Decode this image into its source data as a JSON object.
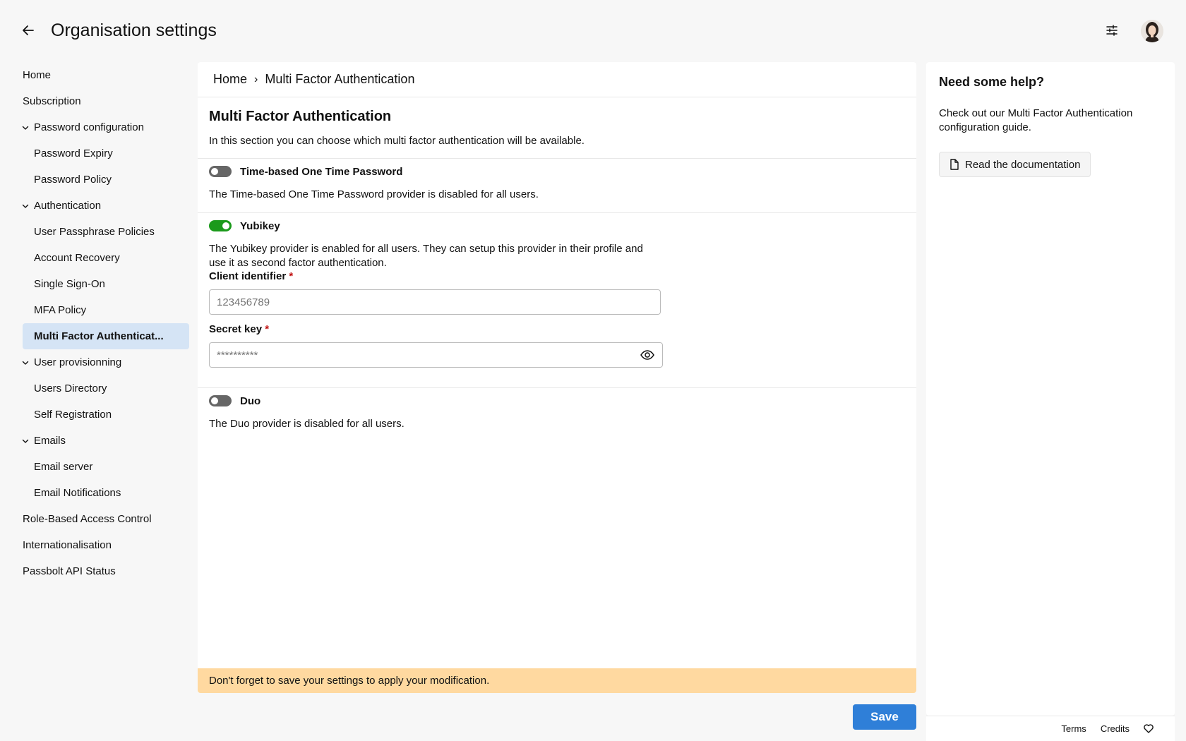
{
  "header": {
    "title": "Organisation settings",
    "back_icon": "arrow-left-icon",
    "filter_icon": "sliders-icon"
  },
  "sidebar": {
    "items": [
      {
        "label": "Home",
        "level": 0
      },
      {
        "label": "Subscription",
        "level": 0
      },
      {
        "label": "Password configuration",
        "level": 0,
        "expanded": true
      },
      {
        "label": "Password Expiry",
        "level": 1
      },
      {
        "label": "Password Policy",
        "level": 1
      },
      {
        "label": "Authentication",
        "level": 0,
        "expanded": true
      },
      {
        "label": "User Passphrase Policies",
        "level": 1
      },
      {
        "label": "Account Recovery",
        "level": 1
      },
      {
        "label": "Single Sign-On",
        "level": 1
      },
      {
        "label": "MFA Policy",
        "level": 1
      },
      {
        "label": "Multi Factor Authenticat...",
        "level": 1,
        "active": true
      },
      {
        "label": "User provisionning",
        "level": 0,
        "expanded": true
      },
      {
        "label": "Users Directory",
        "level": 1
      },
      {
        "label": "Self Registration",
        "level": 1
      },
      {
        "label": "Emails",
        "level": 0,
        "expanded": true
      },
      {
        "label": "Email server",
        "level": 1
      },
      {
        "label": "Email Notifications",
        "level": 1
      },
      {
        "label": "Role-Based Access Control",
        "level": 0
      },
      {
        "label": "Internationalisation",
        "level": 0
      },
      {
        "label": "Passbolt API Status",
        "level": 0
      }
    ]
  },
  "breadcrumb": {
    "home": "Home",
    "separator": "›",
    "current": "Multi Factor Authentication"
  },
  "main": {
    "title": "Multi Factor Authentication",
    "description": "In this section you can choose which multi factor authentication will be available.",
    "totp": {
      "name": "Time-based One Time Password",
      "enabled": false,
      "description": "The Time-based One Time Password provider is disabled for all users."
    },
    "yubikey": {
      "name": "Yubikey",
      "enabled": true,
      "description": "The Yubikey provider is enabled for all users. They can setup this provider in their profile and use it as second factor authentication.",
      "client_label": "Client identifier",
      "client_value": "123456789",
      "secret_label": "Secret key",
      "secret_value": "**********",
      "required_mark": "*"
    },
    "duo": {
      "name": "Duo",
      "enabled": false,
      "description": "The Duo provider is disabled for all users."
    },
    "warning": "Don't forget to save your settings to apply your modification.",
    "save_label": "Save"
  },
  "help": {
    "title": "Need some help?",
    "text": "Check out our Multi Factor Authentication configuration guide.",
    "doc_button": "Read the documentation"
  },
  "footer": {
    "terms": "Terms",
    "credits": "Credits"
  },
  "colors": {
    "accent": "#2f7fd8",
    "toggle_on": "#1b9a1b",
    "active_nav": "#d5e4f5",
    "warning_bg": "#ffd9a0"
  }
}
